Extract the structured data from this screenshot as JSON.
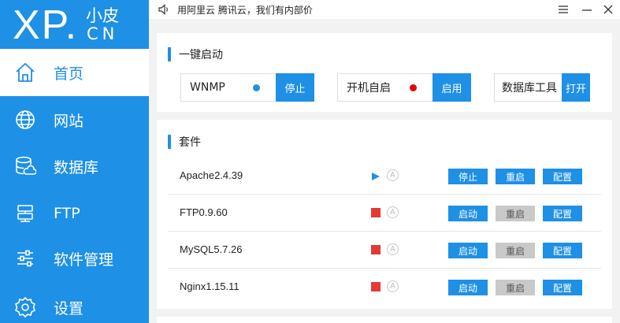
{
  "logo": {
    "main": "XP.",
    "small": "小皮",
    "sub": "CN"
  },
  "nav": [
    {
      "label": "首页",
      "icon": "home-icon"
    },
    {
      "label": "网站",
      "icon": "globe-icon"
    },
    {
      "label": "数据库",
      "icon": "database-icon"
    },
    {
      "label": "FTP",
      "icon": "ftp-icon"
    },
    {
      "label": "软件管理",
      "icon": "sliders-icon"
    },
    {
      "label": "设置",
      "icon": "gear-icon"
    }
  ],
  "topbar": {
    "notice": "用阿里云 腾讯云，我们有内部价"
  },
  "quick_start": {
    "title": "一键启动",
    "items": [
      {
        "label": "WNMP",
        "button": "停止",
        "dot_color": "#1e90e6"
      },
      {
        "label": "开机自启",
        "button": "启用",
        "dot_color": "#e60000"
      },
      {
        "label": "数据库工具",
        "button": "打开"
      }
    ]
  },
  "suite": {
    "title": "套件",
    "auto_symbol": "A",
    "rows": [
      {
        "name": "Apache2.4.39",
        "status": "running",
        "buttons": [
          "停止",
          "重启",
          "配置"
        ],
        "restart_enabled": true
      },
      {
        "name": "FTP0.9.60",
        "status": "stopped",
        "buttons": [
          "启动",
          "重启",
          "配置"
        ],
        "restart_enabled": false
      },
      {
        "name": "MySQL5.7.26",
        "status": "stopped",
        "buttons": [
          "启动",
          "重启",
          "配置"
        ],
        "restart_enabled": false
      },
      {
        "name": "Nginx1.15.11",
        "status": "stopped",
        "buttons": [
          "启动",
          "重启",
          "配置"
        ],
        "restart_enabled": false
      }
    ]
  },
  "colors": {
    "accent": "#1e90e6",
    "stopped": "#e53935",
    "disabled": "#c9c9c9"
  }
}
